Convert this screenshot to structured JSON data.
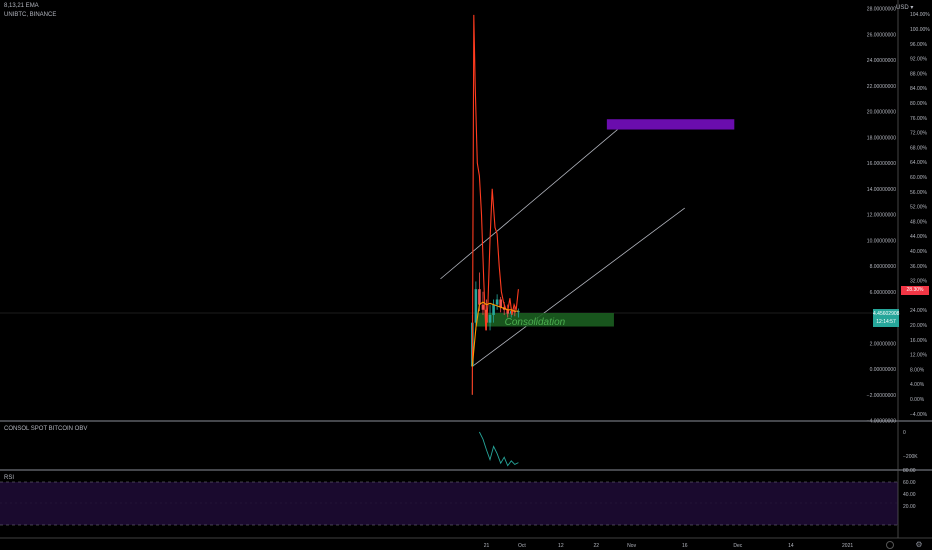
{
  "header": {
    "indicator_label": "8,13,21 EMA",
    "symbol_label": "UNIBTC, BINANCE"
  },
  "currency": "USD",
  "currency_suffix": "▾",
  "price_axis": {
    "ticks": [
      {
        "v": 28,
        "t": "28.00000000"
      },
      {
        "v": 26,
        "t": "26.00000000"
      },
      {
        "v": 24,
        "t": "24.00000000"
      },
      {
        "v": 22,
        "t": "22.00000000"
      },
      {
        "v": 20,
        "t": "20.00000000"
      },
      {
        "v": 18,
        "t": "18.00000000"
      },
      {
        "v": 16,
        "t": "16.00000000"
      },
      {
        "v": 14,
        "t": "14.00000000"
      },
      {
        "v": 12,
        "t": "12.00000000"
      },
      {
        "v": 10,
        "t": "10.00000000"
      },
      {
        "v": 8,
        "t": "8.00000000"
      },
      {
        "v": 6,
        "t": "6.00000000"
      },
      {
        "v": 2,
        "t": "2.00000000"
      },
      {
        "v": 0,
        "t": "0.00000000"
      },
      {
        "v": -2,
        "t": "−2.00000000"
      },
      {
        "v": -4,
        "t": "−4.00000000"
      }
    ],
    "current_price": "4.45602908",
    "countdown": "12:14:57",
    "price_color": "#26a69a"
  },
  "percent_axis": {
    "ticks": [
      {
        "v": 104,
        "t": "104.00%"
      },
      {
        "v": 100,
        "t": "100.00%"
      },
      {
        "v": 96,
        "t": "96.00%"
      },
      {
        "v": 92,
        "t": "92.00%"
      },
      {
        "v": 88,
        "t": "88.00%"
      },
      {
        "v": 84,
        "t": "84.00%"
      },
      {
        "v": 80,
        "t": "80.00%"
      },
      {
        "v": 76,
        "t": "76.00%"
      },
      {
        "v": 72,
        "t": "72.00%"
      },
      {
        "v": 68,
        "t": "68.00%"
      },
      {
        "v": 64,
        "t": "64.00%"
      },
      {
        "v": 60,
        "t": "60.00%"
      },
      {
        "v": 56,
        "t": "56.00%"
      },
      {
        "v": 52,
        "t": "52.00%"
      },
      {
        "v": 48,
        "t": "48.00%"
      },
      {
        "v": 44,
        "t": "44.00%"
      },
      {
        "v": 40,
        "t": "40.00%"
      },
      {
        "v": 36,
        "t": "36.00%"
      },
      {
        "v": 32,
        "t": "32.00%"
      },
      {
        "v": 24,
        "t": "24.00%"
      },
      {
        "v": 20,
        "t": "20.00%"
      },
      {
        "v": 16,
        "t": "16.00%"
      },
      {
        "v": 12,
        "t": "12.00%"
      },
      {
        "v": 8,
        "t": "8.00%"
      },
      {
        "v": 4,
        "t": "4.00%"
      },
      {
        "v": 0,
        "t": "0.00%"
      },
      {
        "v": -4,
        "t": "−4.00%"
      }
    ],
    "ema_percent": "28.30%",
    "ema_color": "#f23645"
  },
  "time_axis": {
    "ticks": [
      {
        "d": 0,
        "t": "21"
      },
      {
        "d": 10,
        "t": "Oct"
      },
      {
        "d": 21,
        "t": "12"
      },
      {
        "d": 31,
        "t": "22"
      },
      {
        "d": 41,
        "t": "Nov"
      },
      {
        "d": 56,
        "t": "16"
      },
      {
        "d": 71,
        "t": "Dec"
      },
      {
        "d": 86,
        "t": "14"
      },
      {
        "d": 102,
        "t": "2021"
      }
    ]
  },
  "drawings": {
    "consolidation_label": "Consolidation",
    "consolidation_color": "#1b5e20",
    "target_box_color": "#6a0dad",
    "channel_color": "#b2b5be"
  },
  "obv_pane": {
    "title": "CONSOL SPOT BITCOIN OBV",
    "ticks": [
      {
        "v": 0,
        "t": "0"
      },
      {
        "v": -200,
        "t": "−200K"
      }
    ],
    "line_color": "#26a69a"
  },
  "rsi_pane": {
    "title": "RSI",
    "ticks": [
      {
        "v": 80,
        "t": "80.00"
      },
      {
        "v": 60,
        "t": "60.00"
      },
      {
        "v": 40,
        "t": "40.00"
      },
      {
        "v": 20,
        "t": "20.00"
      }
    ],
    "band_color": "#1a0a2e"
  },
  "chart_data": {
    "type": "line",
    "title": "",
    "symbol": "UNIBTC, BINANCE",
    "xlabel": "",
    "ylabel": "",
    "ylim": [
      -4,
      28.5
    ],
    "grid": false,
    "candles": [
      {
        "d": -4,
        "o": 0.2,
        "h": 4.2,
        "l": -2.0,
        "c": 3.6
      },
      {
        "d": -3,
        "o": 3.6,
        "h": 6.8,
        "l": 3.0,
        "c": 6.2
      },
      {
        "d": -2,
        "o": 6.2,
        "h": 7.5,
        "l": 4.5,
        "c": 5.0
      },
      {
        "d": -1,
        "o": 5.0,
        "h": 6.0,
        "l": 4.2,
        "c": 4.6
      },
      {
        "d": 0,
        "o": 4.6,
        "h": 5.4,
        "l": 3.0,
        "c": 3.6
      },
      {
        "d": 1,
        "o": 3.6,
        "h": 5.0,
        "l": 3.0,
        "c": 4.2
      },
      {
        "d": 2,
        "o": 4.2,
        "h": 5.4,
        "l": 3.6,
        "c": 5.0
      },
      {
        "d": 3,
        "o": 5.0,
        "h": 5.8,
        "l": 4.6,
        "c": 5.4
      },
      {
        "d": 4,
        "o": 5.4,
        "h": 5.6,
        "l": 4.4,
        "c": 4.8
      },
      {
        "d": 5,
        "o": 4.8,
        "h": 5.2,
        "l": 4.2,
        "c": 4.6
      },
      {
        "d": 6,
        "o": 4.6,
        "h": 5.0,
        "l": 4.0,
        "c": 4.3
      },
      {
        "d": 7,
        "o": 4.3,
        "h": 4.8,
        "l": 4.0,
        "c": 4.5
      },
      {
        "d": 8,
        "o": 4.5,
        "h": 4.9,
        "l": 4.1,
        "c": 4.4
      },
      {
        "d": 9,
        "o": 4.4,
        "h": 4.7,
        "l": 4.0,
        "c": 4.5
      }
    ],
    "series": [
      {
        "x": [
          -4,
          -3.6,
          -3.2,
          -2.6,
          -2,
          -1.4,
          -0.8,
          -0.2,
          0.4,
          1,
          1.6,
          2,
          2.4,
          3,
          3.6,
          4.2,
          4.8,
          5.4,
          6,
          6.6,
          7.2,
          7.8,
          8.4,
          9
        ],
        "values": [
          -2.0,
          27.5,
          22,
          16,
          15,
          12,
          7,
          3,
          5,
          10,
          14,
          12.5,
          11,
          10.5,
          8,
          6,
          5.2,
          4.7,
          4.5,
          5.5,
          4.2,
          5.0,
          4.6,
          6.2
        ]
      },
      {
        "x": [
          -4,
          -3,
          -2,
          -1,
          0,
          1,
          2,
          3,
          4,
          5,
          6,
          7,
          8,
          9
        ],
        "values": [
          0.2,
          3.2,
          5.0,
          5.2,
          5.0,
          5.1,
          5.0,
          4.9,
          4.8,
          4.7,
          4.6,
          4.6,
          4.5,
          4.5
        ]
      }
    ],
    "obv": {
      "x": [
        -2,
        -1,
        0,
        1,
        2,
        3,
        4,
        5,
        6,
        7,
        8,
        9
      ],
      "values": [
        0,
        -60,
        -150,
        -230,
        -120,
        -180,
        -260,
        -210,
        -280,
        -240,
        -270,
        -255
      ]
    },
    "consolidation": {
      "x0": -3,
      "x1": 36,
      "y0": 3.3,
      "y1": 4.35
    },
    "target_box": {
      "x0": 34,
      "x1": 70,
      "y0": 18.6,
      "y1": 19.4
    },
    "channel_lines": [
      {
        "x0": -13,
        "y0": 7.0,
        "x1": 37,
        "y1": 18.6
      },
      {
        "x0": -4,
        "y0": 0.2,
        "x1": 56,
        "y1": 12.5
      }
    ]
  }
}
